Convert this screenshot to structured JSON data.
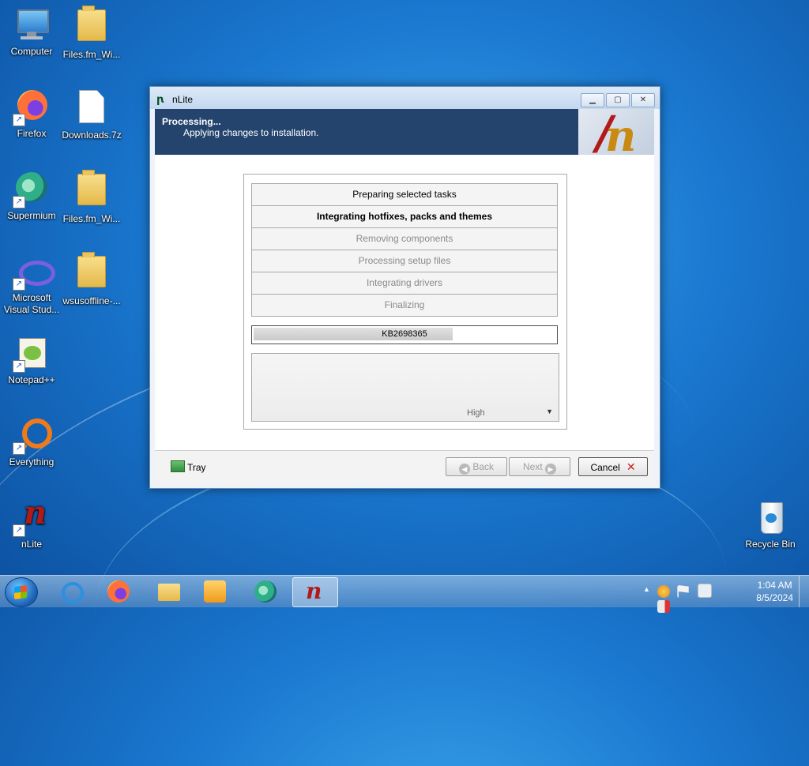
{
  "desktop": {
    "icons": [
      {
        "label": "Computer"
      },
      {
        "label": "Files.fm_Wi..."
      },
      {
        "label": "Firefox"
      },
      {
        "label": "Downloads.7z"
      },
      {
        "label": "Supermium"
      },
      {
        "label": "Files.fm_Wi..."
      },
      {
        "label": "Microsoft Visual Stud..."
      },
      {
        "label": "wsusoffline-..."
      },
      {
        "label": "Notepad++"
      },
      {
        "label": "Everything"
      },
      {
        "label": "nLite"
      },
      {
        "label": "Recycle Bin"
      }
    ]
  },
  "window": {
    "title": "nLite",
    "header": {
      "title": "Processing...",
      "subtitle": "Applying changes to installation."
    },
    "tasks": [
      {
        "label": "Preparing selected tasks",
        "state": "done"
      },
      {
        "label": "Integrating hotfixes, packs and themes",
        "state": "active"
      },
      {
        "label": "Removing components",
        "state": "pending"
      },
      {
        "label": "Processing setup files",
        "state": "pending"
      },
      {
        "label": "Integrating drivers",
        "state": "pending"
      },
      {
        "label": "Finalizing",
        "state": "pending"
      }
    ],
    "progress": {
      "text": "KB2698365",
      "fraction": 0.66
    },
    "priority": {
      "selected": "High"
    },
    "footer": {
      "tray_label": "Tray",
      "back_label": "Back",
      "next_label": "Next",
      "cancel_label": "Cancel"
    }
  },
  "taskbar": {
    "clock_time": "1:04 AM",
    "clock_date": "8/5/2024"
  }
}
